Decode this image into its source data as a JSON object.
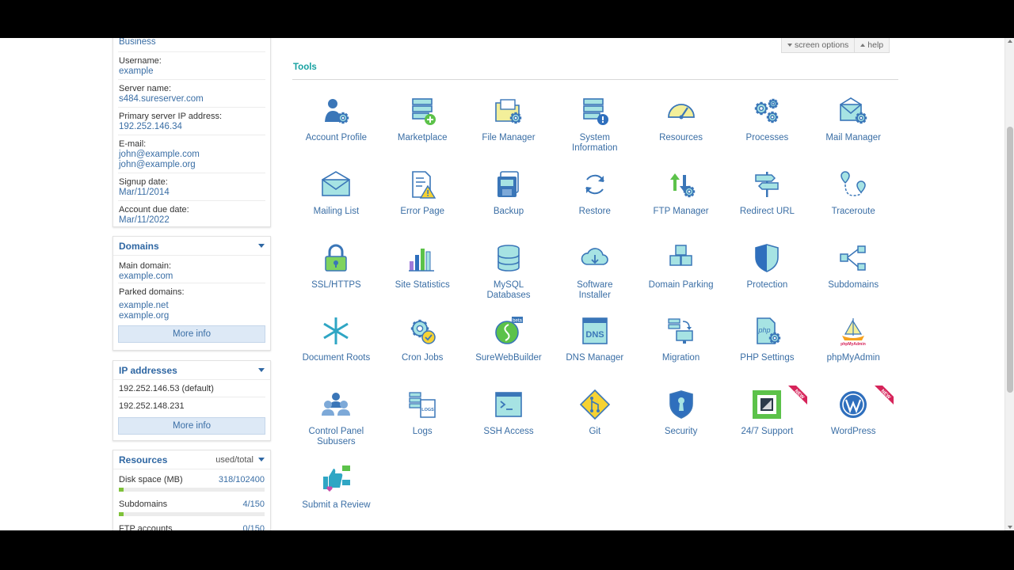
{
  "account": {
    "plan_value": "Business",
    "fields": [
      {
        "label": "Username:",
        "value": "example"
      },
      {
        "label": "Server name:",
        "value": "s484.sureserver.com"
      },
      {
        "label": "Primary server IP address:",
        "value": "192.252.146.34"
      },
      {
        "label": "E-mail:",
        "value": "john@example.com",
        "value2": "john@example.org"
      },
      {
        "label": "Signup date:",
        "value": "Mar/11/2014"
      },
      {
        "label": "Account due date:",
        "value": "Mar/11/2022"
      }
    ]
  },
  "domains": {
    "title": "Domains",
    "main_label": "Main domain:",
    "main_value": "example.com",
    "parked_label": "Parked domains:",
    "parked": [
      "example.net",
      "example.org"
    ],
    "more": "More info"
  },
  "ip": {
    "title": "IP addresses",
    "rows": [
      "192.252.146.53 (default)",
      "192.252.148.231"
    ],
    "more": "More info"
  },
  "resources": {
    "title": "Resources",
    "header_right": "used/total",
    "rows": [
      {
        "label": "Disk space (MB)",
        "value": "318/102400",
        "used_fraction": 0.003
      },
      {
        "label": "Subdomains",
        "value": "4/150",
        "used_fraction": 0.027
      },
      {
        "label": "FTP accounts",
        "value": "0/150",
        "used_fraction": 0
      }
    ]
  },
  "top": {
    "screen_options": "screen options",
    "help": "help"
  },
  "tools": {
    "title": "Tools",
    "items": [
      {
        "label": "Account Profile",
        "icon": "account-profile-icon"
      },
      {
        "label": "Marketplace",
        "icon": "marketplace-icon"
      },
      {
        "label": "File Manager",
        "icon": "file-manager-icon"
      },
      {
        "label": "System\nInformation",
        "icon": "system-information-icon"
      },
      {
        "label": "Resources",
        "icon": "resources-gauge-icon"
      },
      {
        "label": "Processes",
        "icon": "processes-gears-icon"
      },
      {
        "label": "Mail Manager",
        "icon": "mail-manager-icon"
      },
      {
        "label": "Mailing List",
        "icon": "mailing-list-icon"
      },
      {
        "label": "Error Page",
        "icon": "error-page-icon"
      },
      {
        "label": "Backup",
        "icon": "backup-icon"
      },
      {
        "label": "Restore",
        "icon": "restore-icon"
      },
      {
        "label": "FTP Manager",
        "icon": "ftp-manager-icon"
      },
      {
        "label": "Redirect URL",
        "icon": "redirect-url-icon"
      },
      {
        "label": "Traceroute",
        "icon": "traceroute-icon"
      },
      {
        "label": "SSL/HTTPS",
        "icon": "ssl-lock-icon"
      },
      {
        "label": "Site Statistics",
        "icon": "site-statistics-icon"
      },
      {
        "label": "MySQL\nDatabases",
        "icon": "mysql-database-icon"
      },
      {
        "label": "Software\nInstaller",
        "icon": "software-installer-icon"
      },
      {
        "label": "Domain Parking",
        "icon": "domain-parking-icon"
      },
      {
        "label": "Protection",
        "icon": "protection-shield-icon"
      },
      {
        "label": "Subdomains",
        "icon": "subdomains-icon"
      },
      {
        "label": "Document Roots",
        "icon": "document-roots-icon"
      },
      {
        "label": "Cron Jobs",
        "icon": "cron-jobs-icon"
      },
      {
        "label": "SureWebBuilder",
        "icon": "surewebbuilder-icon",
        "badge": "beta"
      },
      {
        "label": "DNS Manager",
        "icon": "dns-manager-icon",
        "badge": "DNS"
      },
      {
        "label": "Migration",
        "icon": "migration-icon"
      },
      {
        "label": "PHP Settings",
        "icon": "php-settings-icon",
        "badge": "php"
      },
      {
        "label": "phpMyAdmin",
        "icon": "phpmyadmin-icon",
        "badge": "phpMyAdmin"
      },
      {
        "label": "Control Panel\nSubusers",
        "icon": "subusers-icon"
      },
      {
        "label": "Logs",
        "icon": "logs-icon",
        "badge": "LOGS"
      },
      {
        "label": "SSH Access",
        "icon": "ssh-access-icon"
      },
      {
        "label": "Git",
        "icon": "git-icon"
      },
      {
        "label": "Security",
        "icon": "security-icon"
      },
      {
        "label": "24/7 Support",
        "icon": "support-icon",
        "ribbon": "NEW"
      },
      {
        "label": "WordPress",
        "icon": "wordpress-icon",
        "ribbon": "NEW"
      },
      {
        "label": "Submit a Review",
        "icon": "submit-review-icon"
      }
    ]
  },
  "colors": {
    "link": "#3a6ea5",
    "accent_teal": "#18a2a2",
    "icon_blue": "#3a76b8",
    "icon_teal_fill": "#a6e3e3",
    "icon_yellow": "#f3ef9a",
    "ribbon": "#d6245a"
  }
}
